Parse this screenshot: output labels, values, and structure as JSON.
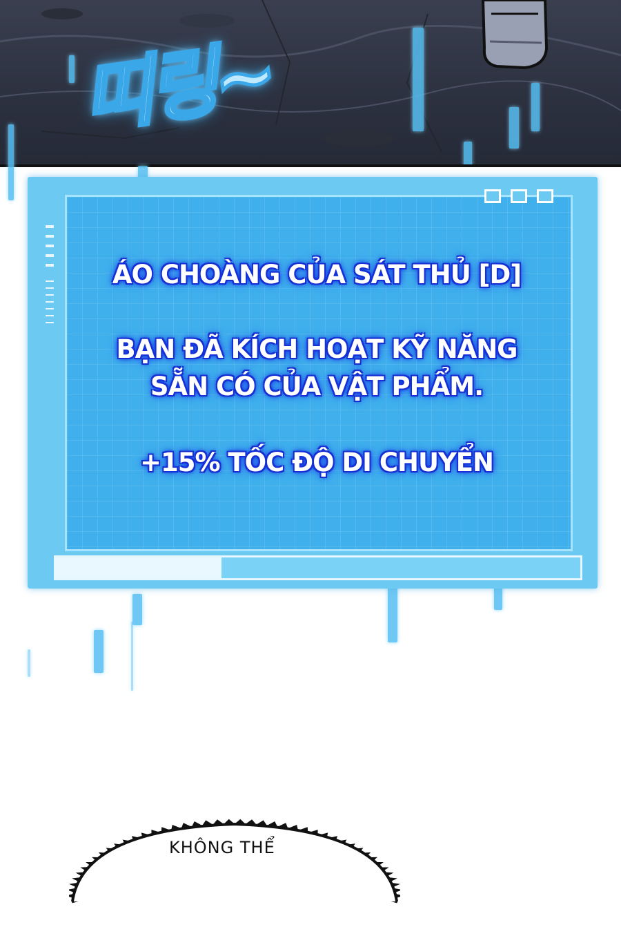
{
  "sfx": {
    "text": "띠링~"
  },
  "system_window": {
    "item_name": "ÁO CHOÀNG CỦA SÁT THỦ [D]",
    "message_line1": "BẠN ĐÃ KÍCH HOẠT KỸ NĂNG",
    "message_line2": "SẴN CÓ CỦA VẬT PHẨM.",
    "effect": "+15% TỐC ĐỘ DI CHUYỂN"
  },
  "speech_bubble": {
    "text": "KHÔNG THỂ"
  },
  "colors": {
    "window_fill": "#3fb0ec",
    "window_frame": "#6cc9f2",
    "text_glow": "#1530d8",
    "sfx_stroke": "#3aa7e8"
  }
}
